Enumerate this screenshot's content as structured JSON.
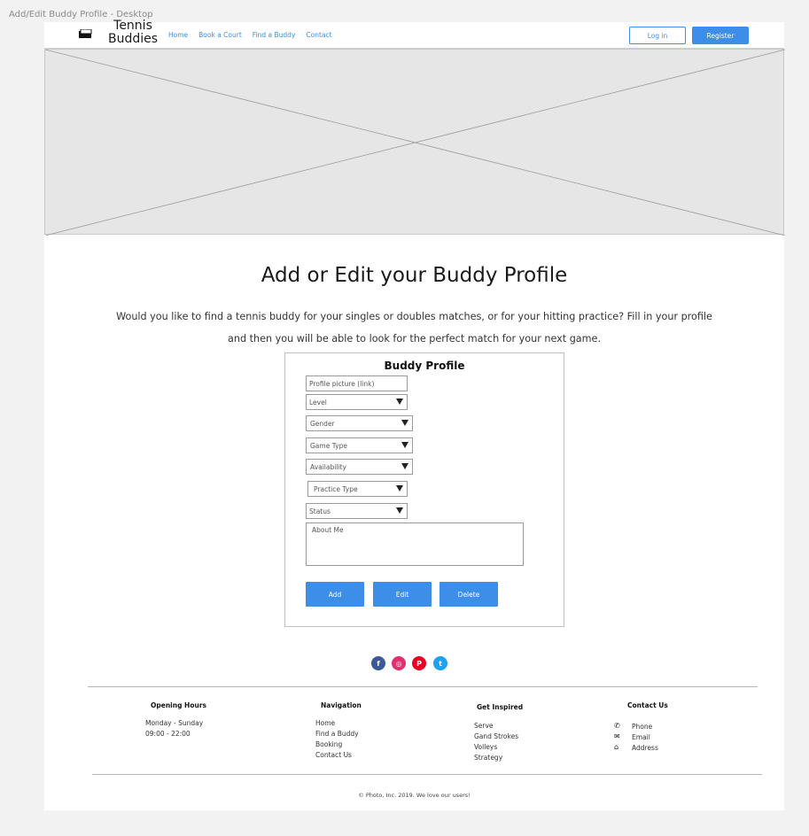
{
  "frame_label": "Add/Edit Buddy Profile - Desktop",
  "header": {
    "logo_line1": "Tennis",
    "logo_line2": "Buddies",
    "nav": [
      "Home",
      "Book a Court",
      "Find a  Buddy",
      "Contact"
    ],
    "login_label": "Log in",
    "register_label": "Register"
  },
  "main": {
    "title": "Add or Edit your Buddy Profile",
    "intro_line1": "Would you like to find a tennis buddy for your singles or doubles matches, or for your hitting practice? Fill in your profile",
    "intro_line2": "and then you will be able to look for the perfect match for your next game."
  },
  "form": {
    "title": "Buddy Profile",
    "profile_picture_placeholder": "Profile picture (link)",
    "level_label": "Level",
    "gender_label": "Gender",
    "game_type_label": "Game Type",
    "availability_label": "Availability",
    "practice_type_label": "Practice Type",
    "status_label": "Status",
    "about_me_placeholder": "About Me",
    "add_label": "Add",
    "edit_label": "Edit",
    "delete_label": "Delete"
  },
  "social": [
    {
      "icon": "facebook-icon",
      "glyph": "f",
      "color": "#3b5998"
    },
    {
      "icon": "instagram-icon",
      "glyph": "◎",
      "color": "#e1306c"
    },
    {
      "icon": "pinterest-icon",
      "glyph": "P",
      "color": "#e60023"
    },
    {
      "icon": "twitter-icon",
      "glyph": "t",
      "color": "#1da1f2"
    }
  ],
  "footer": {
    "opening_hours_title": "Opening Hours",
    "opening_days": "Monday - Sunday",
    "opening_times": "09:00 - 22:00",
    "navigation_title": "Navigation",
    "navigation_items": [
      "Home",
      "Find a Buddy",
      "Booking",
      "Contact Us"
    ],
    "inspired_title": "Get Inspired",
    "inspired_items": [
      "Serve",
      "Gand Strokes",
      "Volleys",
      "Strategy"
    ],
    "contact_title": "Contact Us",
    "contact_items": [
      "Phone",
      "Email",
      "Address"
    ],
    "copyright": "© Photo, Inc. 2019. We love our users!"
  }
}
